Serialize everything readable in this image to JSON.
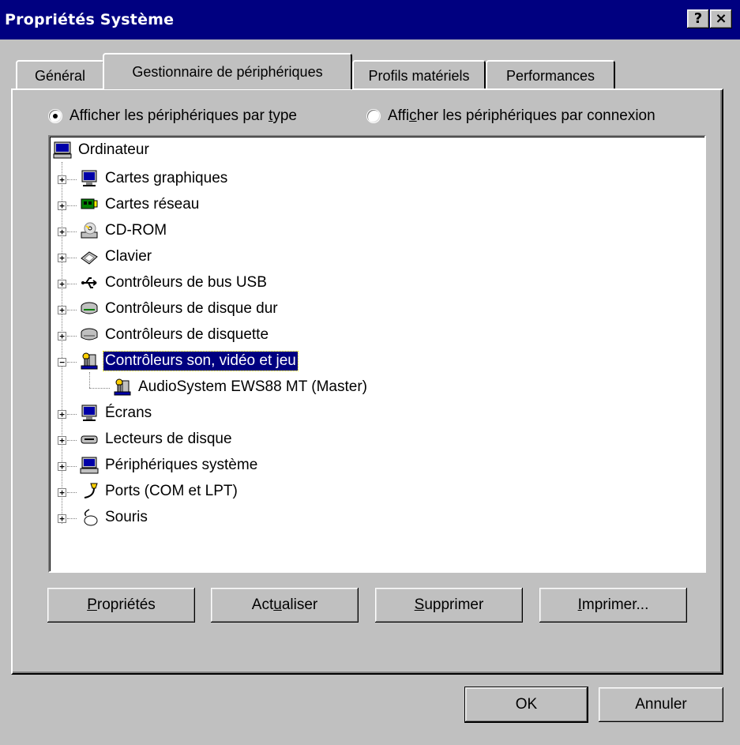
{
  "window": {
    "title": "Propriétés Système",
    "help_button": "?",
    "close_button": "×"
  },
  "tabs": [
    {
      "label": "Général"
    },
    {
      "label": "Gestionnaire de périphériques"
    },
    {
      "label": "Profils matériels"
    },
    {
      "label": "Performances"
    }
  ],
  "view_options": {
    "by_type": {
      "before": "Afficher les périphériques par ",
      "accel": "t",
      "after": "ype",
      "selected": true
    },
    "by_connection": {
      "before": "Affi",
      "accel": "c",
      "after": "her les périphériques par connexion",
      "selected": false
    }
  },
  "tree": {
    "root": "Ordinateur",
    "items": [
      {
        "label": "Cartes graphiques",
        "icon": "display-adapter-icon",
        "expander": "+"
      },
      {
        "label": "Cartes réseau",
        "icon": "network-card-icon",
        "expander": "+"
      },
      {
        "label": "CD-ROM",
        "icon": "cdrom-icon",
        "expander": "+"
      },
      {
        "label": "Clavier",
        "icon": "keyboard-icon",
        "expander": "+"
      },
      {
        "label": "Contrôleurs de bus USB",
        "icon": "usb-icon",
        "expander": "+"
      },
      {
        "label": "Contrôleurs de disque dur",
        "icon": "hard-disk-controller-icon",
        "expander": "+"
      },
      {
        "label": "Contrôleurs de disquette",
        "icon": "floppy-controller-icon",
        "expander": "+"
      },
      {
        "label": "Contrôleurs son, vidéo et jeu",
        "icon": "sound-video-game-icon",
        "expander": "−",
        "selected": true
      },
      {
        "label": "AudioSystem EWS88 MT (Master)",
        "icon": "sound-device-icon",
        "child": true
      },
      {
        "label": "Écrans",
        "icon": "monitor-icon",
        "expander": "+"
      },
      {
        "label": "Lecteurs de disque",
        "icon": "disk-drive-icon",
        "expander": "+"
      },
      {
        "label": "Périphériques système",
        "icon": "system-device-icon",
        "expander": "+"
      },
      {
        "label": "Ports (COM et LPT)",
        "icon": "port-icon",
        "expander": "+"
      },
      {
        "label": "Souris",
        "icon": "mouse-icon",
        "expander": "+"
      }
    ]
  },
  "buttons": {
    "properties": {
      "accel": "P",
      "rest": "ropriétés"
    },
    "refresh": {
      "before": "Act",
      "accel": "u",
      "after": "aliser"
    },
    "remove": {
      "accel": "S",
      "rest": "upprimer"
    },
    "print": {
      "accel": "I",
      "rest": "mprimer..."
    },
    "ok": "OK",
    "cancel": "Annuler"
  }
}
